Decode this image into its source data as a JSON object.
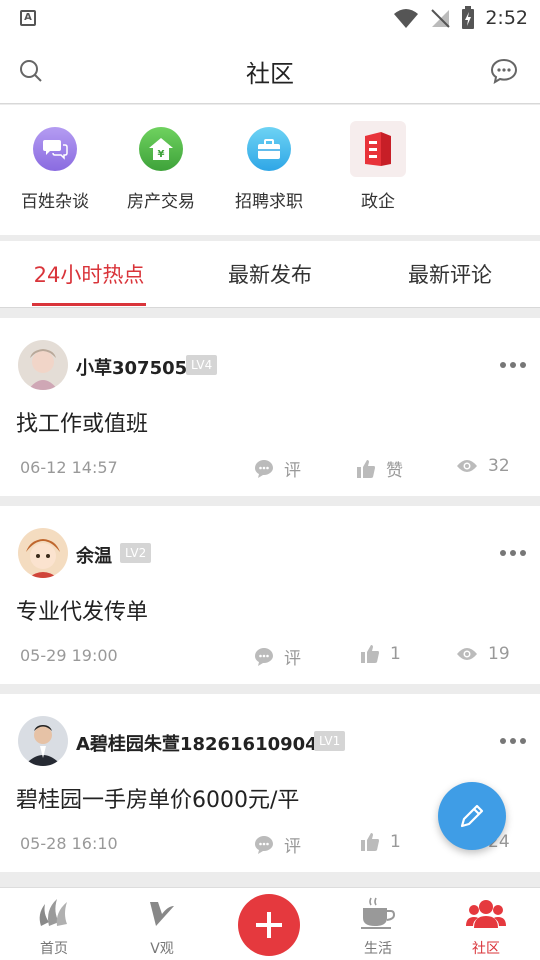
{
  "status_bar": {
    "time": "2:52",
    "app_icon_letter": "A"
  },
  "header": {
    "title": "社区"
  },
  "categories": [
    {
      "label": "百姓杂谈",
      "icon": "chat-bubbles-icon",
      "color": "#9a7fe6"
    },
    {
      "label": "房产交易",
      "icon": "house-yuan-icon",
      "color": "#4fb84a"
    },
    {
      "label": "招聘求职",
      "icon": "briefcase-icon",
      "color": "#3fb6ea"
    },
    {
      "label": "政企",
      "icon": "building-icon",
      "color": "#e8333a"
    }
  ],
  "tabs": [
    {
      "label": "24小时热点",
      "active": true
    },
    {
      "label": "最新发布",
      "active": false
    },
    {
      "label": "最新评论",
      "active": false
    }
  ],
  "posts": [
    {
      "user": "小草307505",
      "level": "LV4",
      "title": "找工作或值班",
      "date": "06-12 14:57",
      "comment": "评",
      "like": "赞",
      "views": "32"
    },
    {
      "user": "余温",
      "level": "LV2",
      "title": "专业代发传单",
      "date": "05-29 19:00",
      "comment": "评",
      "like": "1",
      "views": "19"
    },
    {
      "user": "A碧桂园朱萱18261610904",
      "level": "LV1",
      "title": "碧桂园一手房单价6000元/平",
      "date": "05-28 16:10",
      "comment": "评",
      "like": "1",
      "views": "24"
    }
  ],
  "bottom_nav": [
    {
      "label": "首页",
      "icon": "home-logo-icon",
      "active": false
    },
    {
      "label": "V观",
      "icon": "v-logo-icon",
      "active": false
    },
    {
      "label": "生活",
      "icon": "coffee-cup-icon",
      "active": false
    },
    {
      "label": "社区",
      "icon": "people-icon",
      "active": true
    }
  ],
  "colors": {
    "accent": "#d9343a",
    "fab": "#3f9de6"
  }
}
